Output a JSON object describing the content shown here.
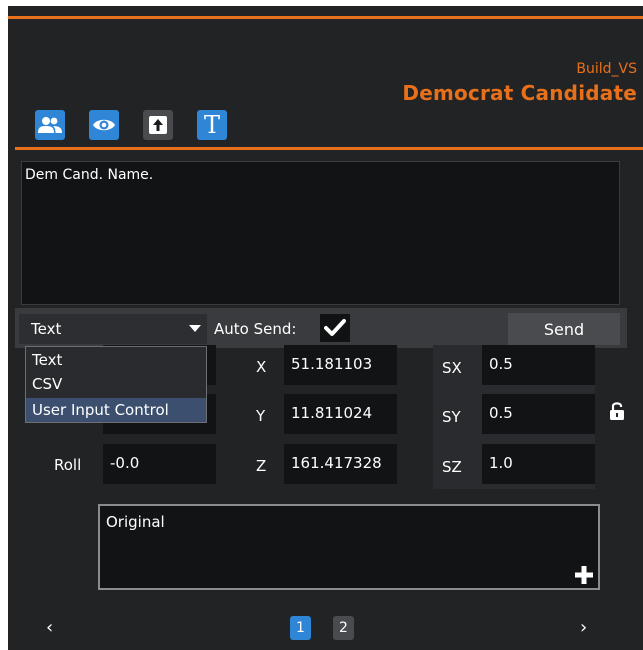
{
  "header": {
    "subtitle": "Build_VS",
    "title": "Democrat Candidate"
  },
  "toolbar": {
    "buttons": [
      {
        "icon": "users-icon"
      },
      {
        "icon": "eye-icon"
      },
      {
        "icon": "upload-arrow-icon"
      },
      {
        "icon": "text-icon",
        "glyph": "T"
      }
    ]
  },
  "editor": {
    "value": "Dem Cand. Name."
  },
  "controls": {
    "type_select_value": "Text",
    "type_options": [
      "Text",
      "CSV",
      "User Input Control"
    ],
    "highlighted_option": "User Input Control",
    "auto_send_label": "Auto Send:",
    "auto_send_checked": true,
    "send_label": "Send"
  },
  "transform": {
    "roll_label": "Roll",
    "roll_value": "-0.0",
    "x_label": "X",
    "x_value": "51.181103",
    "y_label": "Y",
    "y_value": "11.811024",
    "z_label": "Z",
    "z_value": "161.417328",
    "sx_label": "SX",
    "sx_value": "0.5",
    "sy_label": "SY",
    "sy_value": "0.5",
    "sz_label": "SZ",
    "sz_value": "1.0"
  },
  "original": {
    "value": "Original"
  },
  "pagination": {
    "prev": "‹",
    "next": "›",
    "pages": [
      "1",
      "2"
    ],
    "current": "1"
  },
  "colors": {
    "accent": "#e8701a",
    "blue": "#2f86d6",
    "panel": "#222325"
  }
}
